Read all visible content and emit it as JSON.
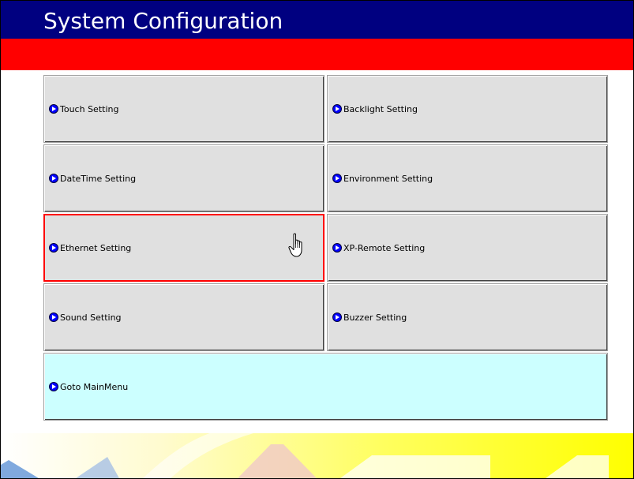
{
  "title": "System Configuration",
  "buttons": {
    "touch": "Touch Setting",
    "backlight": "Backlight Setting",
    "datetime": "DateTime Setting",
    "environment": "Environment Setting",
    "ethernet": "Ethernet Setting",
    "xp_remote": "XP-Remote Setting",
    "sound": "Sound Setting",
    "buzzer": "Buzzer Setting",
    "goto_main": "Goto MainMenu"
  },
  "selected_button": "Ethernet Setting",
  "icons": {
    "button_bullet": "arrow-circle-icon",
    "pointer": "hand-cursor-icon"
  },
  "colors": {
    "title_bar": "#000080",
    "accent_band": "#ff0000",
    "button_face": "#e0e0e0",
    "main_menu_button": "#ccffff",
    "selection_border": "#ff0000",
    "watermark": "#ffff00"
  }
}
